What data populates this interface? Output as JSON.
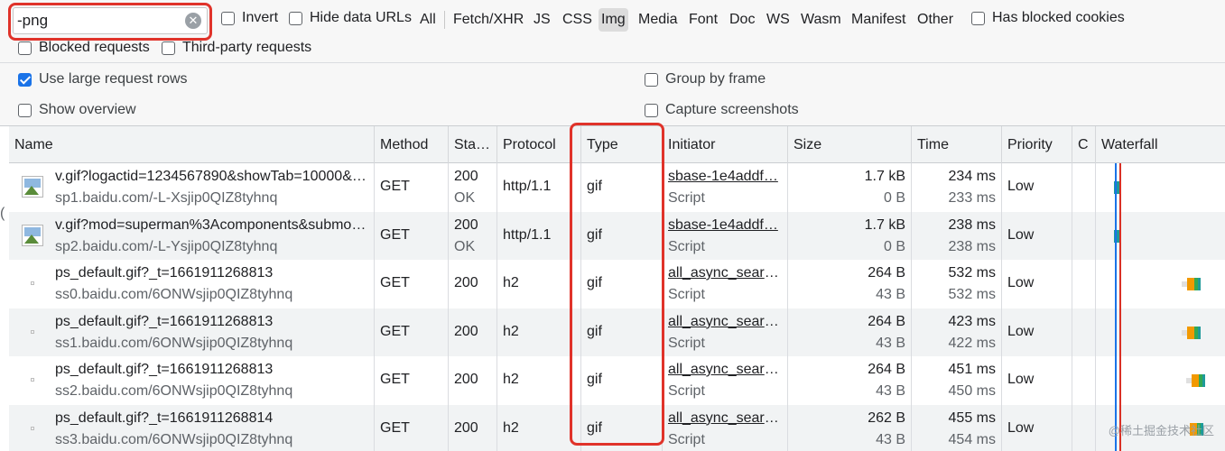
{
  "filter": {
    "search_value": "-png",
    "invert_label": "Invert",
    "hide_data_urls_label": "Hide data URLs",
    "types": [
      "All",
      "Fetch/XHR",
      "JS",
      "CSS",
      "Img",
      "Media",
      "Font",
      "Doc",
      "WS",
      "Wasm",
      "Manifest",
      "Other"
    ],
    "active_type": "Img",
    "has_blocked_cookies_label": "Has blocked cookies",
    "blocked_requests_label": "Blocked requests",
    "third_party_label": "Third-party requests"
  },
  "settings": {
    "large_rows_label": "Use large request rows",
    "large_rows_checked": true,
    "show_overview_label": "Show overview",
    "group_by_frame_label": "Group by frame",
    "capture_screenshots_label": "Capture screenshots"
  },
  "table": {
    "columns": {
      "name": "Name",
      "method": "Method",
      "status": "Sta…",
      "protocol": "Protocol",
      "type": "Type",
      "initiator": "Initiator",
      "size": "Size",
      "time": "Time",
      "priority": "Priority",
      "c": "C",
      "waterfall": "Waterfall"
    },
    "rows": [
      {
        "name": "v.gif?logactid=1234567890&showTab=10000&…",
        "host": "sp1.baidu.com/-L-Xsjip0QIZ8tyhnq",
        "method": "GET",
        "status": "200",
        "status_text": "OK",
        "protocol": "http/1.1",
        "type": "gif",
        "initiator": "sbase-1e4addf…",
        "initiator_type": "Script",
        "size": "1.7 kB",
        "resource_size": "0 B",
        "time": "234 ms",
        "latency": "233 ms",
        "priority": "Low",
        "icon": "image-thumbnail-icon"
      },
      {
        "name": "v.gif?mod=superman%3Acomponents&submo…",
        "host": "sp2.baidu.com/-L-Ysjip0QIZ8tyhnq",
        "method": "GET",
        "status": "200",
        "status_text": "OK",
        "protocol": "http/1.1",
        "type": "gif",
        "initiator": "sbase-1e4addf…",
        "initiator_type": "Script",
        "size": "1.7 kB",
        "resource_size": "0 B",
        "time": "238 ms",
        "latency": "238 ms",
        "priority": "Low",
        "icon": "image-thumbnail-icon"
      },
      {
        "name": "ps_default.gif?_t=1661911268813",
        "host": "ss0.baidu.com/6ONWsjip0QIZ8tyhnq",
        "method": "GET",
        "status": "200",
        "status_text": "",
        "protocol": "h2",
        "type": "gif",
        "initiator": "all_async_searc…",
        "initiator_type": "Script",
        "size": "264 B",
        "resource_size": "43 B",
        "time": "532 ms",
        "latency": "532 ms",
        "priority": "Low",
        "icon": "tiny-image-icon"
      },
      {
        "name": "ps_default.gif?_t=1661911268813",
        "host": "ss1.baidu.com/6ONWsjip0QIZ8tyhnq",
        "method": "GET",
        "status": "200",
        "status_text": "",
        "protocol": "h2",
        "type": "gif",
        "initiator": "all_async_searc…",
        "initiator_type": "Script",
        "size": "264 B",
        "resource_size": "43 B",
        "time": "423 ms",
        "latency": "422 ms",
        "priority": "Low",
        "icon": "tiny-image-icon"
      },
      {
        "name": "ps_default.gif?_t=1661911268813",
        "host": "ss2.baidu.com/6ONWsjip0QIZ8tyhnq",
        "method": "GET",
        "status": "200",
        "status_text": "",
        "protocol": "h2",
        "type": "gif",
        "initiator": "all_async_searc…",
        "initiator_type": "Script",
        "size": "264 B",
        "resource_size": "43 B",
        "time": "451 ms",
        "latency": "450 ms",
        "priority": "Low",
        "icon": "tiny-image-icon"
      },
      {
        "name": "ps_default.gif?_t=1661911268814",
        "host": "ss3.baidu.com/6ONWsjip0QIZ8tyhnq",
        "method": "GET",
        "status": "200",
        "status_text": "",
        "protocol": "h2",
        "type": "gif",
        "initiator": "all_async_searc…",
        "initiator_type": "Script",
        "size": "262 B",
        "resource_size": "43 B",
        "time": "455 ms",
        "latency": "454 ms",
        "priority": "Low",
        "icon": "tiny-image-icon"
      }
    ]
  },
  "colors": {
    "highlight": "#e0332a",
    "checkbox_checked": "#1a73e8",
    "waterfall_blue": "#1a73e8",
    "waterfall_red": "#d93025",
    "waterfall_teal": "#1e9a9a",
    "waterfall_orange": "#f29900",
    "waterfall_green": "#34a853"
  },
  "watermark": "@稀土掘金技术社区"
}
